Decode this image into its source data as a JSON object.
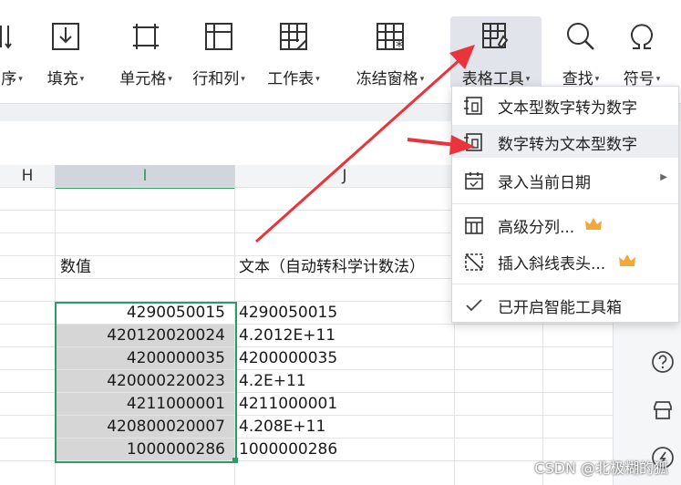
{
  "ribbon": {
    "items": [
      {
        "label": "序",
        "icon": "sort-icon"
      },
      {
        "label": "填充",
        "icon": "fill-icon"
      },
      {
        "label": "单元格",
        "icon": "cell-icon"
      },
      {
        "label": "行和列",
        "icon": "rows-columns-icon"
      },
      {
        "label": "工作表",
        "icon": "worksheet-icon"
      },
      {
        "label": "冻结窗格",
        "icon": "freeze-panes-icon"
      },
      {
        "label": "表格工具",
        "icon": "table-tools-icon"
      },
      {
        "label": "查找",
        "icon": "search-icon"
      },
      {
        "label": "符号",
        "icon": "omega-symbol-icon"
      }
    ]
  },
  "grid": {
    "columns": {
      "H": "H",
      "I": "I",
      "J": "J"
    },
    "header_row": {
      "col_i": "数值",
      "col_j": "文本（自动转科学计数法）"
    },
    "rows": [
      {
        "i": "4290050015",
        "j": "4290050015"
      },
      {
        "i": "420120020024",
        "j": "4.2012E+11"
      },
      {
        "i": "4200000035",
        "j": "4200000035"
      },
      {
        "i": "420000220023",
        "j": "4.2E+11"
      },
      {
        "i": "4211000001",
        "j": "4211000001"
      },
      {
        "i": "420800020007",
        "j": "4.208E+11"
      },
      {
        "i": "1000000286",
        "j": "1000000286"
      }
    ]
  },
  "menu": {
    "items": [
      {
        "label": "文本型数字转为数字",
        "icon": "text-to-number-icon"
      },
      {
        "label": "数字转为文本型数字",
        "icon": "number-to-text-icon"
      },
      {
        "label": "录入当前日期",
        "icon": "calendar-icon"
      },
      {
        "label": "高级分列...",
        "icon": "split-columns-icon"
      },
      {
        "label": "插入斜线表头...",
        "icon": "diagonal-header-icon"
      },
      {
        "label": "已开启智能工具箱",
        "icon": "checkmark-icon"
      }
    ]
  },
  "watermark": "CSDN @北极糊的狐",
  "colors": {
    "accent_green": "#2e9a66",
    "annotation_red": "#e8343a",
    "premium_crown": "#f2a83b"
  }
}
